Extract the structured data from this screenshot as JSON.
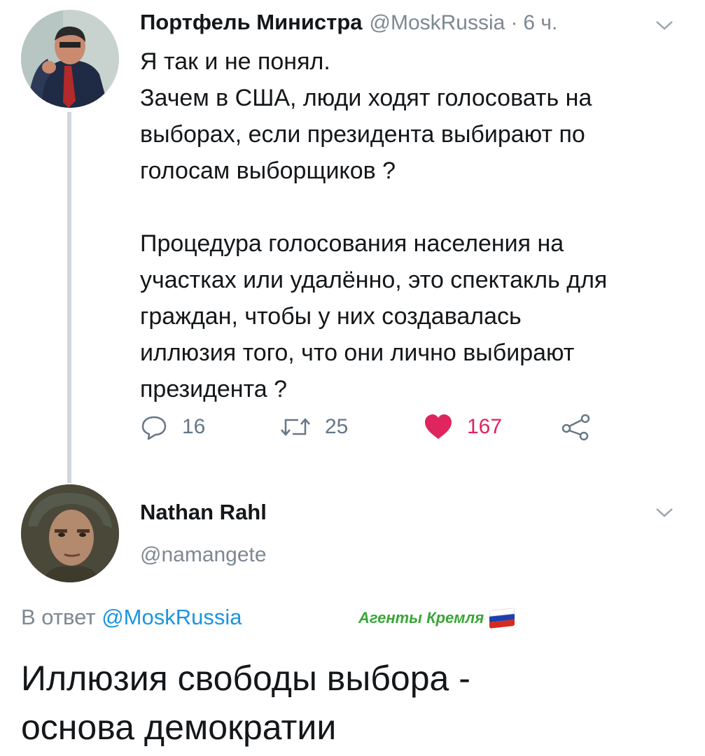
{
  "tweet1": {
    "author_name": "Портфель Министра",
    "handle": "@MoskRussia",
    "separator": "·",
    "time": "6 ч.",
    "avatar_icon": "user-avatar-man-with-tie",
    "body_lines": [
      "Я так и не понял.",
      "Зачем в США, люди ходят голосовать на",
      "выборах, если президента выбирают по",
      "голосам выборщиков ?",
      "",
      "Процедура голосования населения на",
      "участках или удалённо, это спектакль для",
      "граждан, чтобы у них создавалась",
      "иллюзия того, что они лично выбирают",
      "президента ?"
    ],
    "actions": {
      "reply_count": "16",
      "retweet_count": "25",
      "like_count": "167",
      "reply_icon": "reply-bubble-icon",
      "retweet_icon": "retweet-icon",
      "like_icon": "heart-icon",
      "share_icon": "share-icon"
    },
    "colors": {
      "like": "#e0245e",
      "meta": "#7d8891",
      "thread_line": "#d0d6da"
    }
  },
  "tweet2": {
    "author_name": "Nathan Rahl",
    "handle": "@namangete",
    "avatar_icon": "user-avatar-soldier-helmet",
    "reply_prefix": "В ответ",
    "reply_mention": "@MoskRussia",
    "body_lines": [
      "Иллюзия свободы выбора -",
      "основа демократии"
    ],
    "colors": {
      "mention": "#1b95e0"
    }
  },
  "watermark": {
    "text": "Агенты Кремля",
    "flag_icon": "russian-flag-icon",
    "color": "#3aa63a"
  }
}
